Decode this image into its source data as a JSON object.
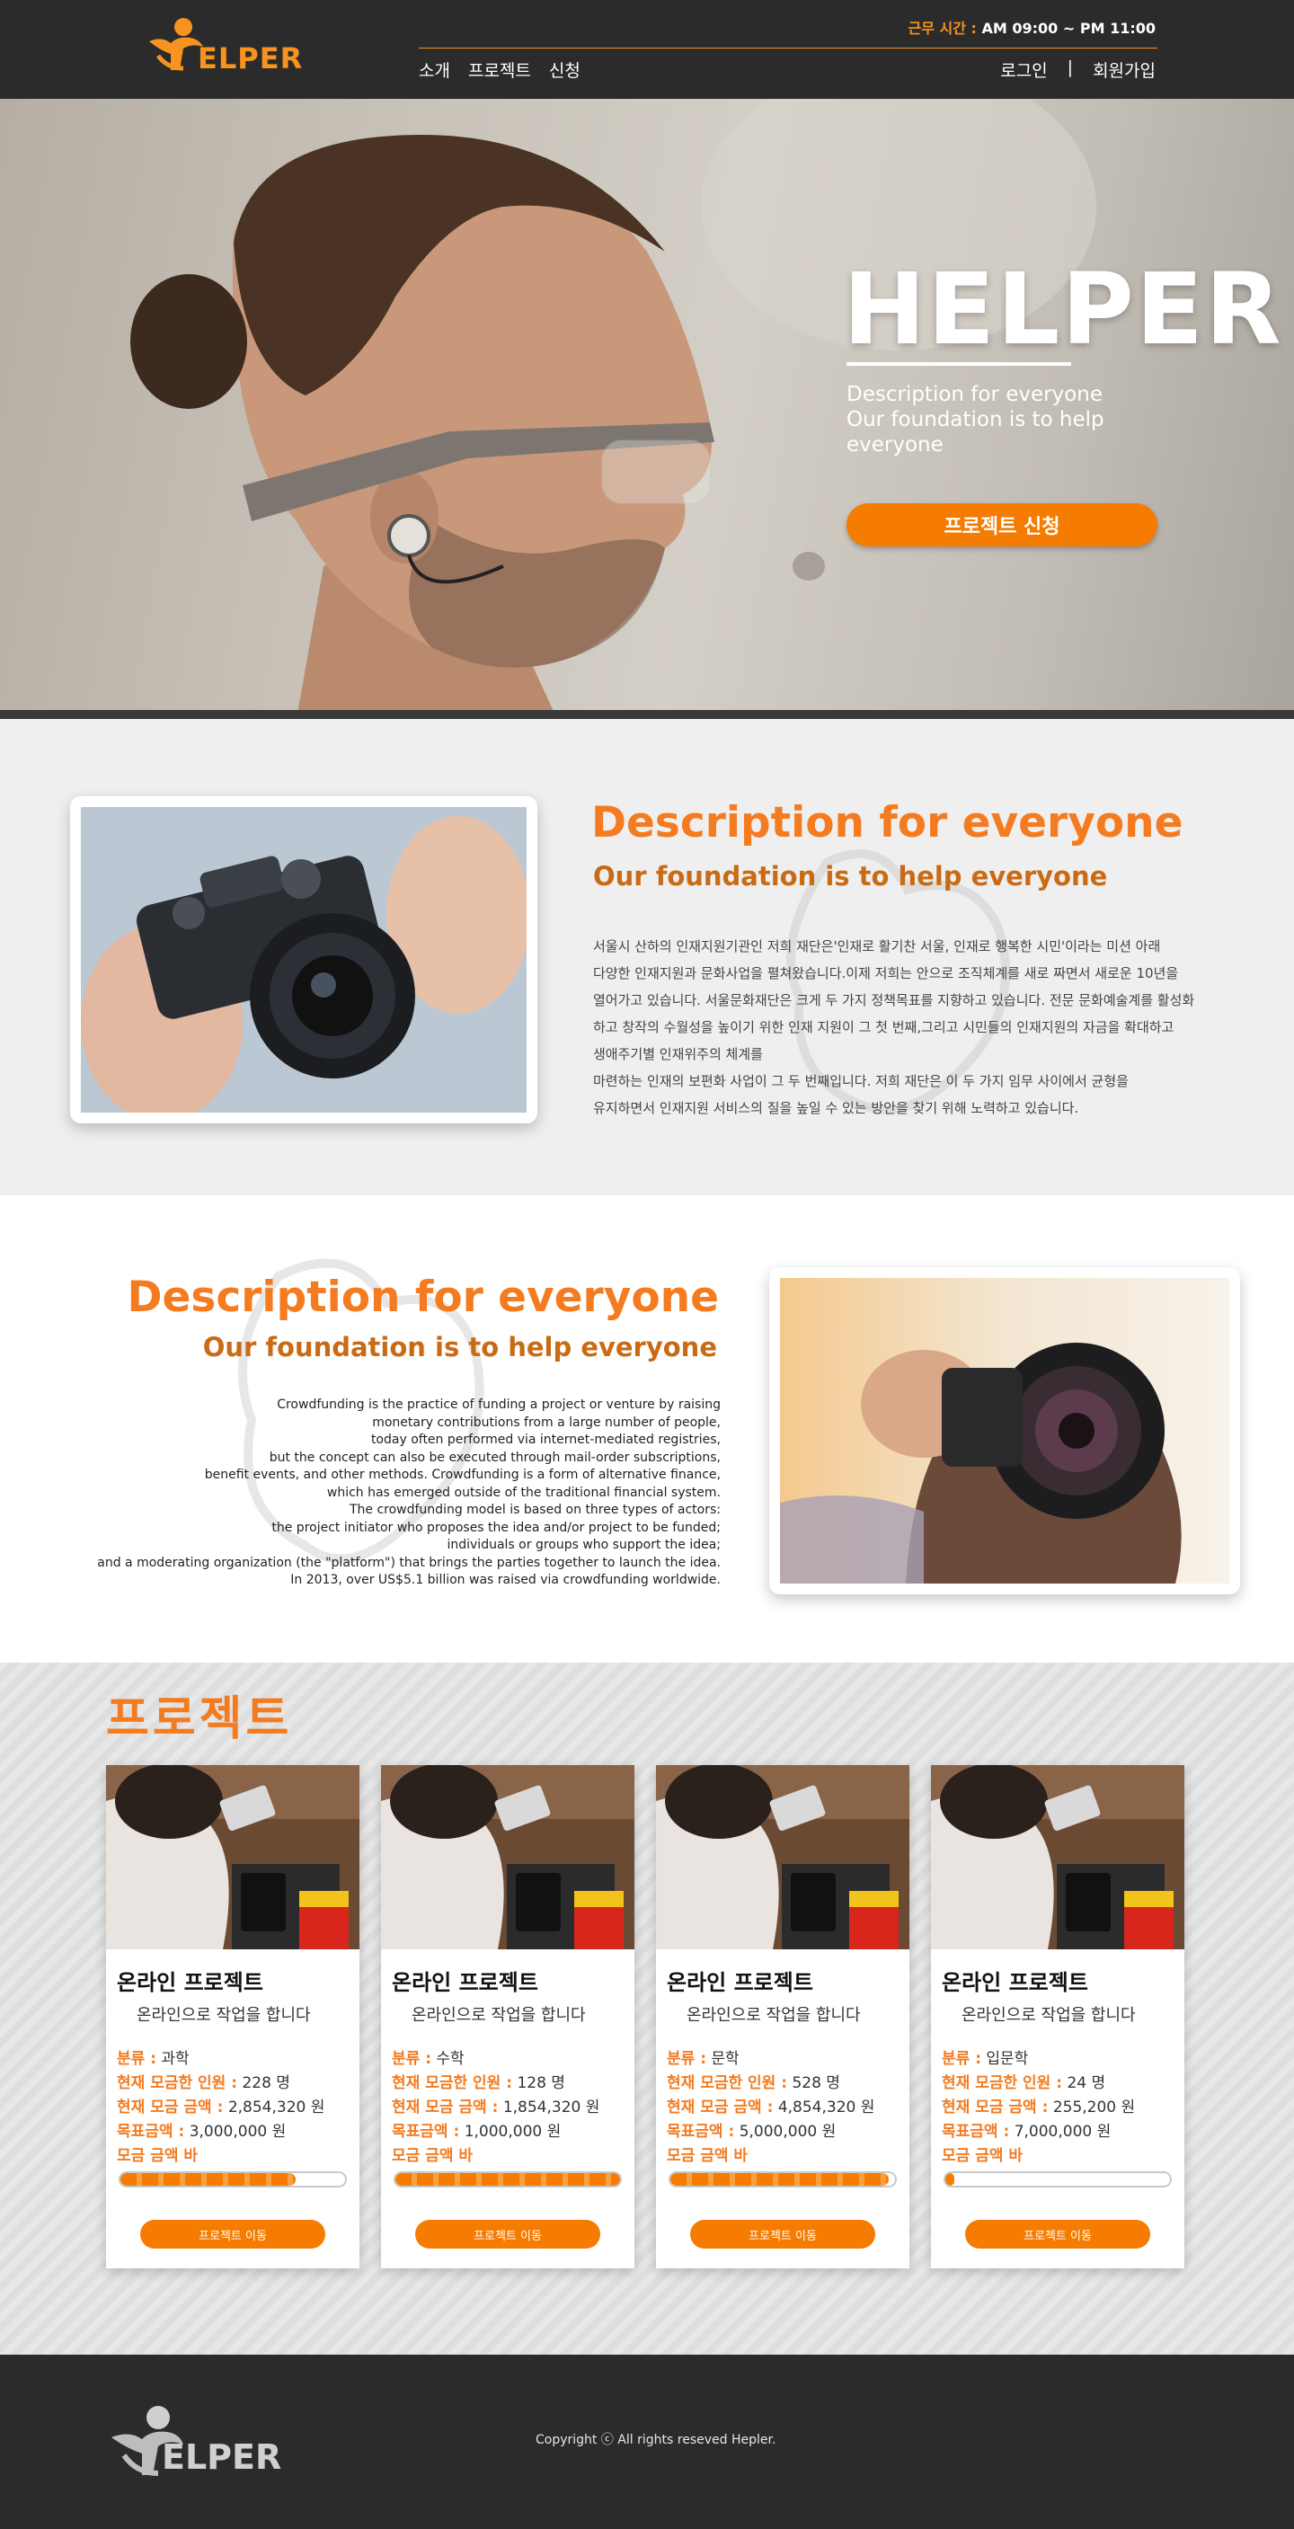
{
  "header": {
    "logo_text": "ELPER",
    "hours_label": "근무 시간 :",
    "hours_value": "AM 09:00 ~ PM 11:00",
    "nav": [
      "소개",
      "프로젝트",
      "신청"
    ],
    "login": "로그인",
    "separator": "|",
    "signup": "회원가입"
  },
  "hero": {
    "title": "HELPER",
    "description": "Description for everyone Our foundation is to help everyone",
    "button": "프로젝트 신청"
  },
  "section1": {
    "title": "Description for everyone",
    "subtitle": "Our foundation is to help everyone",
    "lines": [
      "서울시 산하의 인재지원기관인 저희 재단은'인재로 활기찬 서울, 인재로 행복한 시민'이라는 미션 아래",
      "다양한 인재지원과 문화사업을 펼쳐왔습니다.이제 저희는 안으로 조직체계를 새로 짜면서 새로운 10년을",
      " 열어가고 있습니다. 서울문화재단은 크게 두 가지 정책목표를 지향하고 있습니다. 전문 문화예술계를 활성화",
      "하고 창작의 수월성을 높이기 위한 인재 지원이 그 첫 번째,그리고 시민들의 인재지원의 자금을 확대하고",
      "생애주기별 인재위주의 체계를",
      "마련하는 인재의 보편화 사업이 그 두 번째입니다. 저희 재단은 이 두 가지 임무 사이에서 균형을",
      "유지하면서  인재지원 서비스의 질을 높일 수 있는 방안을 찾기 위해 노력하고 있습니다."
    ]
  },
  "section2": {
    "title": "Description for everyone",
    "subtitle": "Our foundation is to help everyone",
    "lines": [
      "Crowdfunding is the practice of funding a project or venture by raising",
      "monetary contributions from a large number of people,",
      "today often performed via internet-mediated registries,",
      "but the concept can also be executed through mail-order subscriptions,",
      "benefit events, and other methods. Crowdfunding is a form of alternative finance,",
      "which has emerged outside of the traditional financial system.",
      "The crowdfunding model is based on three types of actors:",
      "the project initiator who proposes the idea and/or project to be funded;",
      "individuals or groups who support the idea;",
      "and a moderating organization (the \"platform\") that brings the parties together to launch the idea.",
      "In 2013, over US$5.1 billion was raised via crowdfunding worldwide."
    ]
  },
  "projects": {
    "title": "프로젝트",
    "labels": {
      "category": "분류 :",
      "people": "현재 모금한 인원 :",
      "amount": "현재 모금 금액 :",
      "goal": "목표금액 :",
      "bar": "모금 금액 바"
    },
    "items": [
      {
        "title": "온라인 프로젝트",
        "sub": "온라인으로 작업을 합니다",
        "category": "과학",
        "people": "228 명",
        "amount": "2,854,320 원",
        "goal": "3,000,000 원",
        "progress": 0.78,
        "button": "프로젝트 이동"
      },
      {
        "title": "온라인 프로젝트",
        "sub": "온라인으로 작업을 합니다",
        "category": "수학",
        "people": "128 명",
        "amount": "1,854,320 원",
        "goal": "1,000,000 원",
        "progress": 1.0,
        "button": "프로젝트 이동"
      },
      {
        "title": "온라인 프로젝트",
        "sub": "온라인으로 작업을 합니다",
        "category": "문학",
        "people": "528 명",
        "amount": "4,854,320 원",
        "goal": "5,000,000 원",
        "progress": 0.97,
        "button": "프로젝트 이동"
      },
      {
        "title": "온라인 프로젝트",
        "sub": "온라인으로 작업을 합니다",
        "category": "입문학",
        "people": "24 명",
        "amount": "255,200 원",
        "goal": "7,000,000 원",
        "progress": 0.04,
        "button": "프로젝트 이동"
      }
    ]
  },
  "footer": {
    "logo_text": "ELPER",
    "copyright": "Copyright ⓒ All rights reseved Hepler."
  },
  "colors": {
    "accent": "#f47b20",
    "dark": "#2b2b2b"
  }
}
